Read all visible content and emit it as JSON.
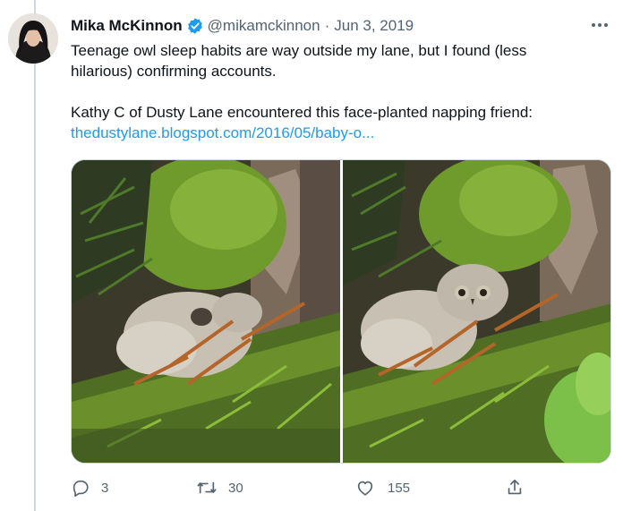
{
  "tweet": {
    "author_name": "Mika McKinnon",
    "handle": "@mikamckinnon",
    "separator": "·",
    "date": "Jun 3, 2019",
    "text_line1": "Teenage owl sleep habits are way outside my lane, but I found (less hilarious) confirming accounts.",
    "text_line2": "Kathy C of Dusty Lane encountered this face-planted napping friend:",
    "link_text": "thedustylane.blogspot.com/2016/05/baby-o..."
  },
  "actions": {
    "reply_count": "3",
    "retweet_count": "30",
    "like_count": "155"
  },
  "colors": {
    "link": "#1d9bf0",
    "secondary_text": "#536471",
    "verified_badge": "#1d9bf0",
    "moss": "#5f8a2a"
  },
  "icons": [
    "verified-badge-icon",
    "more-options-icon",
    "reply-icon",
    "retweet-icon",
    "like-icon",
    "share-icon"
  ]
}
